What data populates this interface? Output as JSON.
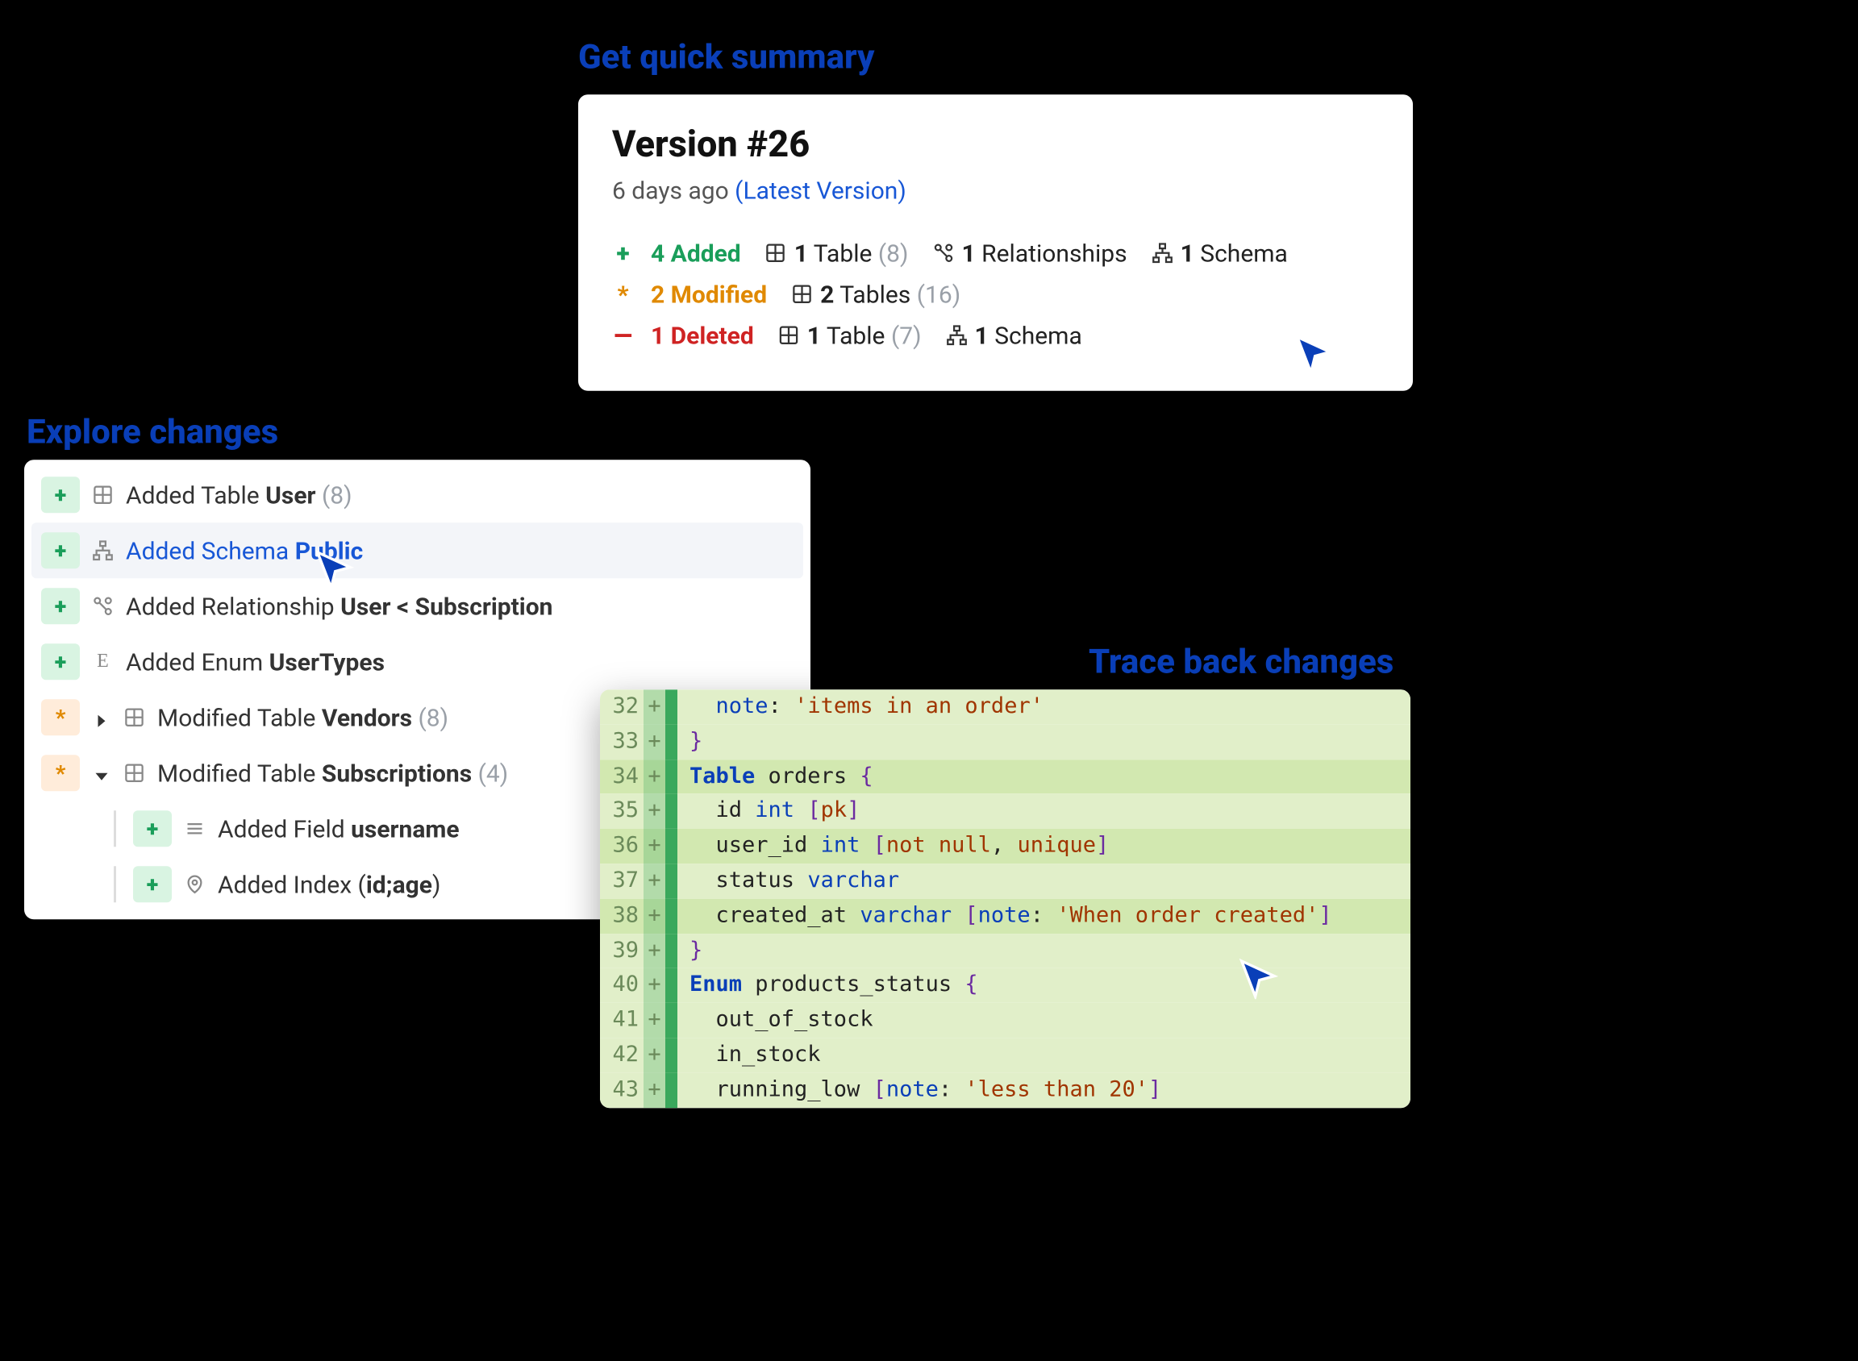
{
  "captions": {
    "summary": "Get quick summary",
    "explore": "Explore changes",
    "trace": "Trace back changes"
  },
  "summary": {
    "title": "Version #26",
    "age": "6 days ago",
    "latest": "(Latest Version)",
    "added": {
      "count": "4 Added",
      "table_n": "1",
      "table_lbl": "Table",
      "table_paren": "(8)",
      "rel_n": "1",
      "rel_lbl": "Relationships",
      "schema_n": "1",
      "schema_lbl": "Schema"
    },
    "modified": {
      "count": "2 Modified",
      "tables_n": "2",
      "tables_lbl": "Tables",
      "tables_paren": "(16)"
    },
    "deleted": {
      "count": "1 Deleted",
      "table_n": "1",
      "table_lbl": "Table",
      "table_paren": "(7)",
      "schema_n": "1",
      "schema_lbl": "Schema"
    }
  },
  "explore": {
    "row1": {
      "prefix": "Added Table ",
      "bold": "User",
      "count": " (8)"
    },
    "row2": {
      "prefix": "Added Schema ",
      "bold": "Public"
    },
    "row3": {
      "prefix": "Added Relationship ",
      "bold": "User < Subscription"
    },
    "row4": {
      "prefix": "Added Enum ",
      "bold": "UserTypes"
    },
    "row5": {
      "prefix": "Modified Table ",
      "bold": "Vendors",
      "count": " (8)"
    },
    "row6": {
      "prefix": "Modified Table ",
      "bold": "Subscriptions",
      "count": " (4)"
    },
    "row7": {
      "prefix": "Added Field ",
      "bold": "username"
    },
    "row8": {
      "prefix": "Added Index (",
      "bold": "id;age",
      "suffix": ")"
    }
  },
  "code": {
    "l32": {
      "n": "32",
      "a": "note",
      "b": ": ",
      "s": "'items in an order'"
    },
    "l33": {
      "n": "33",
      "b": "}"
    },
    "l34": {
      "n": "34",
      "k": "Table",
      "name": " orders ",
      "b": "{"
    },
    "l35": {
      "n": "35",
      "f": "  id ",
      "t": "int",
      "sp": " ",
      "ob": "[",
      "a": "pk",
      "cb": "]"
    },
    "l36": {
      "n": "36",
      "f": "  user_id ",
      "t": "int",
      "sp": " ",
      "ob": "[",
      "a": "not null",
      "c": ", ",
      "a2": "unique",
      "cb": "]"
    },
    "l37": {
      "n": "37",
      "f": "  status ",
      "t": "varchar"
    },
    "l38": {
      "n": "38",
      "f": "  created_at ",
      "t": "varchar",
      "sp": " ",
      "ob": "[",
      "a": "note",
      "col": ": ",
      "s": "'When order created'",
      "cb": "]"
    },
    "l39": {
      "n": "39",
      "b": "}"
    },
    "l40": {
      "n": "40",
      "k": "Enum",
      "name": " products_status ",
      "b": "{"
    },
    "l41": {
      "n": "41",
      "f": "  out_of_stock"
    },
    "l42": {
      "n": "42",
      "f": "  in_stock"
    },
    "l43": {
      "n": "43",
      "f": "  running_low ",
      "ob": "[",
      "a": "note",
      "col": ": ",
      "s": "'less than 20'",
      "cb": "]"
    }
  }
}
